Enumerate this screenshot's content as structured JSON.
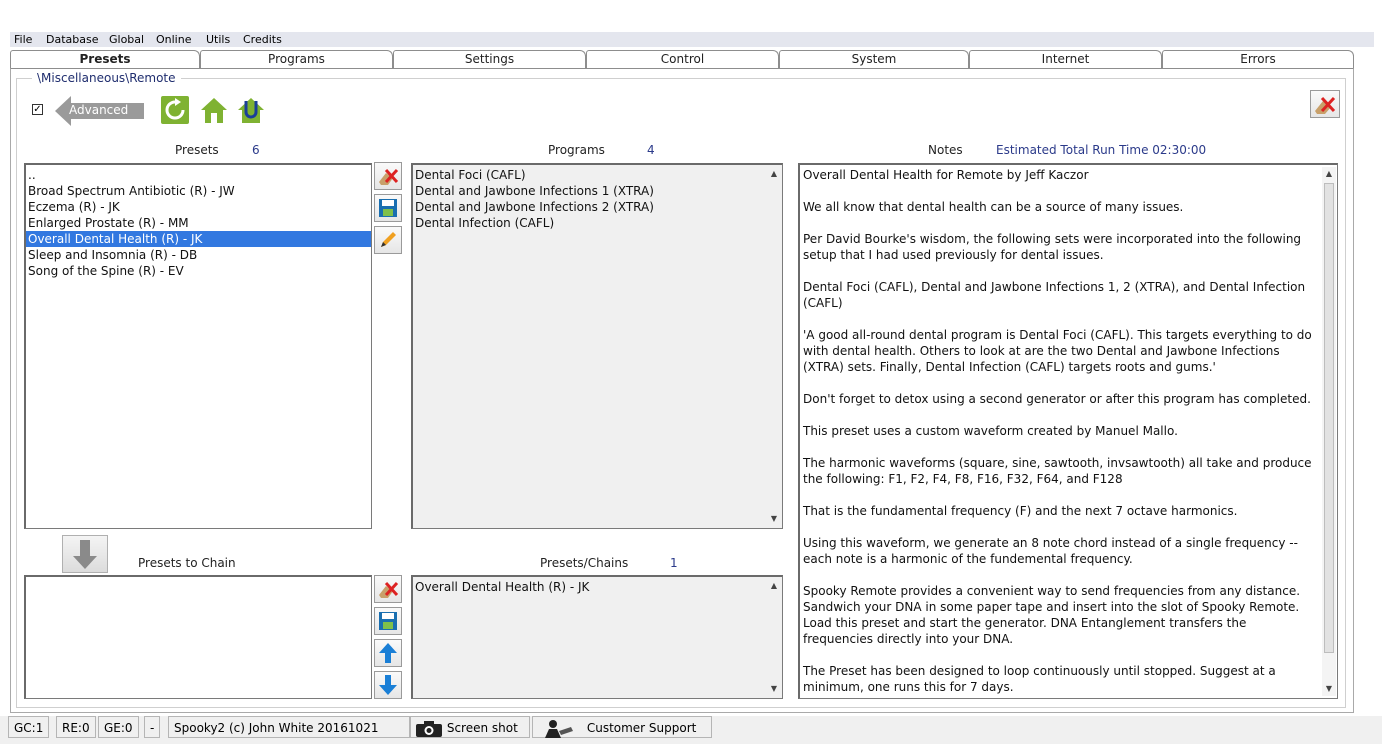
{
  "menu": [
    "File",
    "Database",
    "Global",
    "Online",
    "Utils",
    "Credits"
  ],
  "tabs": [
    "Presets",
    "Programs",
    "Settings",
    "Control",
    "System",
    "Internet",
    "Errors"
  ],
  "path": "\\Miscellaneous\\Remote",
  "advanced": {
    "checked": "✓",
    "label": "Advanced"
  },
  "presets": {
    "header": "Presets",
    "count": "6",
    "items": [
      "..",
      "Broad Spectrum Antibiotic (R) - JW",
      "Eczema (R) - JK",
      "Enlarged Prostate (R) - MM",
      "Overall Dental Health (R) - JK",
      "Sleep and Insomnia (R) - DB",
      "Song of the Spine (R) - EV"
    ],
    "selected_index": 4
  },
  "programs": {
    "header": "Programs",
    "count": "4",
    "items": [
      "Dental Foci (CAFL)",
      "Dental and Jawbone Infections 1 (XTRA)",
      "Dental and Jawbone Infections 2 (XTRA)",
      "Dental Infection (CAFL)"
    ]
  },
  "notes": {
    "header": "Notes",
    "runtime": "Estimated Total Run Time 02:30:00",
    "paragraphs": [
      "Overall Dental Health for Remote by Jeff Kaczor",
      "We all know that dental health can be a source of many issues.",
      "Per David Bourke's wisdom, the following sets were incorporated into the following setup that I had used previously for dental issues.",
      "Dental Foci (CAFL), Dental and Jawbone Infections 1, 2 (XTRA), and Dental Infection (CAFL)",
      "'A good all-round dental program is Dental Foci (CAFL).  This targets everything to do with dental health.  Others to look at are the two Dental and Jawbone Infections (XTRA) sets. Finally, Dental Infection (CAFL) targets roots and gums.'",
      "Don't forget to detox using a second generator or after this program has completed.",
      "This preset uses a custom waveform created by Manuel Mallo.",
      "The harmonic waveforms (square, sine, sawtooth, invsawtooth) all take and produce the following: F1, F2, F4, F8, F16, F32, F64, and F128",
      "That is the fundamental frequency (F) and the next 7 octave harmonics.",
      "Using this waveform, we generate an 8 note chord instead of a single frequency -- each note is a harmonic of the fundemental frequency.",
      "Spooky Remote provides a convenient way to send frequencies from any distance. Sandwich your DNA in some paper tape and insert into the slot of Spooky Remote. Load this preset and start the generator. DNA Entanglement transfers the frequencies directly into your DNA.",
      "The Preset has been designed to loop continuously until stopped.  Suggest at a minimum, one runs this for 7 days."
    ]
  },
  "presets_to_chain": {
    "header": "Presets to Chain"
  },
  "presets_chains": {
    "header": "Presets/Chains",
    "count": "1",
    "items": [
      "Overall Dental Health (R) - JK"
    ]
  },
  "status": {
    "gc": "GC:1",
    "re": "RE:0",
    "ge": "GE:0",
    "dash": "-",
    "credit": "Spooky2 (c) John White 20161021",
    "screenshot": "Screen shot",
    "support": "Customer Support"
  },
  "colors": {
    "accent": "#3278e0",
    "icon_green": "#7fb232",
    "arrow_blue": "#1a7fd6",
    "label_blue": "#2b3a8a"
  }
}
